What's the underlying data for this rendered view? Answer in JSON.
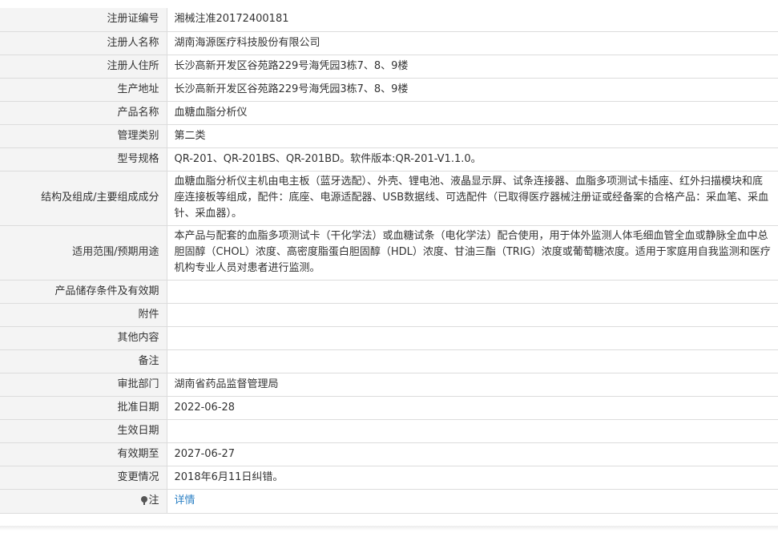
{
  "rows": [
    {
      "label": "注册证编号",
      "value": "湘械注准20172400181"
    },
    {
      "label": "注册人名称",
      "value": "湖南海源医疗科技股份有限公司"
    },
    {
      "label": "注册人住所",
      "value": "长沙高新开发区谷苑路229号海凭园3栋7、8、9楼"
    },
    {
      "label": "生产地址",
      "value": "长沙高新开发区谷苑路229号海凭园3栋7、8、9楼"
    },
    {
      "label": "产品名称",
      "value": "血糖血脂分析仪"
    },
    {
      "label": "管理类别",
      "value": "第二类"
    },
    {
      "label": "型号规格",
      "value": "QR-201、QR-201BS、QR-201BD。软件版本:QR-201-V1.1.0。"
    },
    {
      "label": "结构及组成/主要组成成分",
      "value": "血糖血脂分析仪主机由电主板（蓝牙选配）、外壳、锂电池、液晶显示屏、试条连接器、血脂多项测试卡插座、红外扫描模块和底座连接板等组成，配件：底座、电源适配器、USB数据线、可选配件（已取得医疗器械注册证或经备案的合格产品：采血笔、采血针、采血器）。"
    },
    {
      "label": "适用范围/预期用途",
      "value": "本产品与配套的血脂多项测试卡（干化学法）或血糖试条（电化学法）配合使用，用于体外监测人体毛细血管全血或静脉全血中总胆固醇（CHOL）浓度、高密度脂蛋白胆固醇（HDL）浓度、甘油三酯（TRIG）浓度或葡萄糖浓度。适用于家庭用自我监测和医疗机构专业人员对患者进行监测。"
    },
    {
      "label": "产品储存条件及有效期",
      "value": ""
    },
    {
      "label": "附件",
      "value": ""
    },
    {
      "label": "其他内容",
      "value": ""
    },
    {
      "label": "备注",
      "value": ""
    },
    {
      "label": "审批部门",
      "value": "湖南省药品监督管理局"
    },
    {
      "label": "批准日期",
      "value": "2022-06-28"
    },
    {
      "label": "生效日期",
      "value": ""
    },
    {
      "label": "有效期至",
      "value": "2027-06-27"
    },
    {
      "label": "变更情况",
      "value": "2018年6月11日纠错。"
    }
  ],
  "note": {
    "label": "注",
    "icon": "pin-icon",
    "link_text": "详情"
  },
  "colors": {
    "label_bg": "#f4f4f4",
    "border": "#dcdcdc",
    "link": "#2a7fc4",
    "text": "#333333"
  }
}
